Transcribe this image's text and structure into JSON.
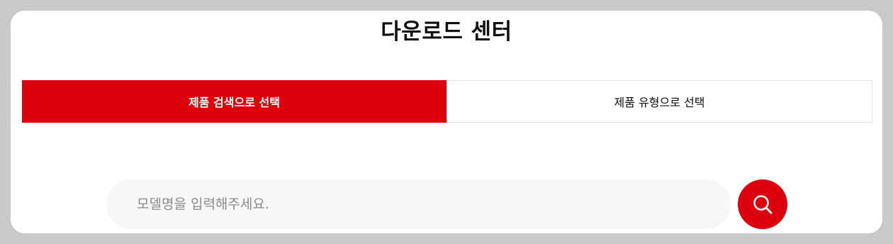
{
  "page": {
    "title": "다운로드 센터"
  },
  "tabs": [
    {
      "label": "제품 검색으로 선택",
      "active": true
    },
    {
      "label": "제품 유형으로 선택",
      "active": false
    }
  ],
  "search": {
    "placeholder": "모델명을 입력해주세요.",
    "value": "",
    "button_icon": "search-icon"
  },
  "colors": {
    "accent": "#dd000d",
    "page_background": "#c9c9c9",
    "panel_background": "#ffffff",
    "input_background": "#f7f7f7"
  }
}
